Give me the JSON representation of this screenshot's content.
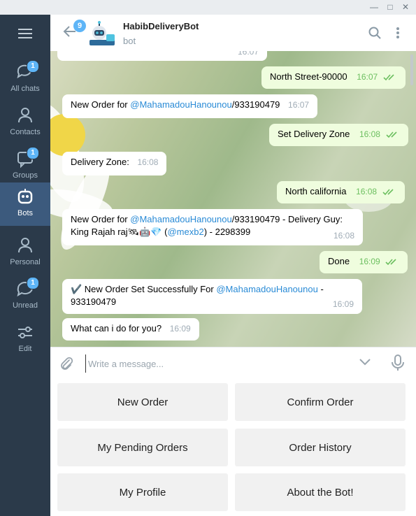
{
  "window": {
    "minimize_icon": "minimize-icon",
    "maximize_icon": "maximize-icon",
    "close_icon": "close-icon"
  },
  "sidebar": {
    "items": [
      {
        "label": "All chats",
        "icon": "chats-icon",
        "badge": "1"
      },
      {
        "label": "Contacts",
        "icon": "person-icon",
        "badge": ""
      },
      {
        "label": "Groups",
        "icon": "chat-bubble-icon",
        "badge": "1"
      },
      {
        "label": "Bots",
        "icon": "robot-icon",
        "badge": ""
      },
      {
        "label": "Personal",
        "icon": "person-icon",
        "badge": ""
      },
      {
        "label": "Unread",
        "icon": "chat-bubble-icon",
        "badge": "1"
      },
      {
        "label": "Edit",
        "icon": "sliders-icon",
        "badge": ""
      }
    ]
  },
  "header": {
    "back_badge": "9",
    "title": "HabibDeliveryBot",
    "subtitle": "bot"
  },
  "messages": [
    {
      "text": "North Street-90000",
      "time": "16:07"
    },
    {
      "prefix": "New Order for ",
      "mention": "@MahamadouHanounou",
      "suffix": "/933190479",
      "time": "16:07"
    },
    {
      "text": "Set Delivery Zone",
      "time": "16:08"
    },
    {
      "text": "Delivery Zone:",
      "time": "16:08"
    },
    {
      "text": "North california",
      "time": "16:08"
    },
    {
      "prefix": "New Order for ",
      "mention": "@MahamadouHanounou",
      "suffix": "/933190479 - Delivery Guy:",
      "line2_prefix": "King Rajah raj🛰🤖💎 (",
      "line2_mention": "@mexb2",
      "line2_suffix": ") - 2298399",
      "time": "16:08"
    },
    {
      "text": "Done",
      "time": "16:09"
    },
    {
      "prefix": "✔️ New Order Set Successfully For ",
      "mention": "@MahamadouHanounou",
      "suffix": " -",
      "line2": "933190479",
      "time": "16:09"
    },
    {
      "text": "What can i do for you?",
      "time": "16:09"
    }
  ],
  "top_partial_time": "16:07",
  "composer": {
    "placeholder": "Write a message..."
  },
  "keyboard": [
    "New Order",
    "Confirm Order",
    "My Pending Orders",
    "Order History",
    "My Profile",
    "About the Bot!"
  ]
}
